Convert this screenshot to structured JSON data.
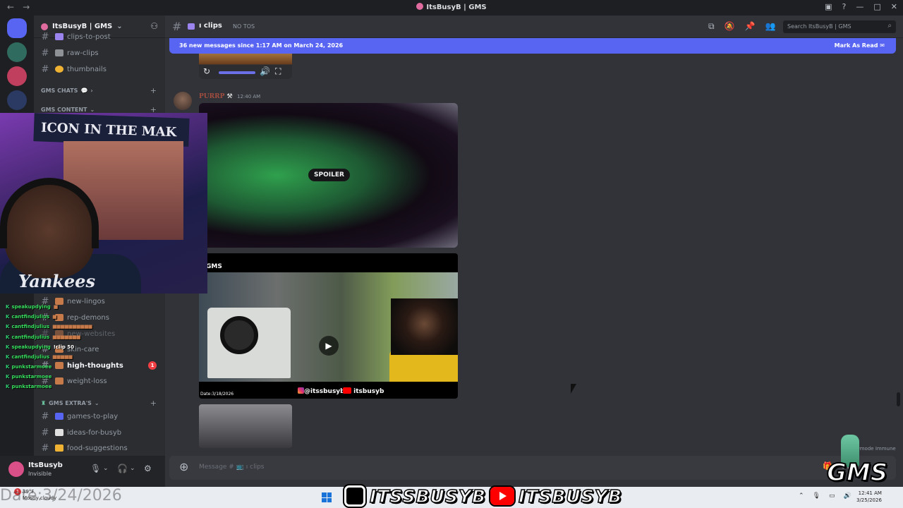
{
  "window": {
    "title": "ItsBusyB | GMS",
    "controls": [
      "—",
      "□",
      "✕"
    ]
  },
  "server": {
    "name": "ItsBusyB | GMS",
    "accent": "#e06c9f"
  },
  "sidebar": {
    "channels_top": [
      {
        "name": "clips-to-post"
      },
      {
        "name": "raw-clips"
      },
      {
        "name": "thumbnails"
      }
    ],
    "categories": {
      "chats": "GMS CHATS",
      "content": "GMS CONTENT",
      "extras": "GMS EXTRA'S"
    },
    "channels_mid": [
      {
        "name": "new-lingos"
      },
      {
        "name": "rep-demons"
      },
      {
        "name": "new-websites"
      },
      {
        "name": "skin-care"
      },
      {
        "name": "high-thoughts",
        "unread": "1"
      },
      {
        "name": "weight-loss"
      }
    ],
    "channels_extra": [
      {
        "name": "games-to-play"
      },
      {
        "name": "ideas-for-busyb"
      },
      {
        "name": "food-suggestions"
      }
    ]
  },
  "user_panel": {
    "name": "ItsBusyb",
    "status": "Invisible"
  },
  "header": {
    "channel": "clips",
    "topic": "NO TOS",
    "search_placeholder": "Search ItsBusyB | GMS"
  },
  "new_messages_bar": {
    "text": "36 new messages since 1:17 AM on March 24, 2026",
    "action": "Mark As Read",
    "color": "#5865f2"
  },
  "message": {
    "author": "PURRP",
    "time": "12:40 AM",
    "spoiler_label": "SPOILER",
    "video_gms_tag": "GMS",
    "video_date": "Date:3/18/2026",
    "video_ig": "@itssbusyb",
    "video_yt": "itsbusyb"
  },
  "composer": {
    "placeholder": "Message # 📺 ı clips"
  },
  "slowmode": "Slowmode Immune",
  "webcam": {
    "banner": "ICON IN THE MAK",
    "shirt": "Yankees"
  },
  "chat_overlay": [
    {
      "user": "speakupdying",
      "text": ""
    },
    {
      "user": "cantfindjulius",
      "text": ""
    },
    {
      "user": "cantfindjulius",
      "text": ""
    },
    {
      "user": "cantfindjulius",
      "text": ""
    },
    {
      "user": "speakupdying",
      "text": "!clip 50"
    },
    {
      "user": "cantfindjulius",
      "text": ""
    },
    {
      "user": "punkstarmoee",
      "text": ""
    },
    {
      "user": "punkstarmoee",
      "text": ""
    },
    {
      "user": "punkstarmoee",
      "text": ""
    }
  ],
  "taskbar": {
    "date_overlay": "Date:3/24/2026",
    "weather_temp": "39°F",
    "weather_desc": "Mostly cloudy",
    "notification_count": "1",
    "social_ig": "ITSSBUSYB",
    "social_yt": "ITSBUSYB",
    "clock_date": "3/25/2026",
    "clock_time": "12:41 AM"
  },
  "brand_logo": "GMS"
}
